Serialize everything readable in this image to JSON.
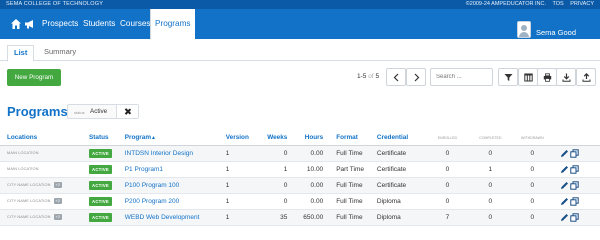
{
  "topbar": {
    "school": "SEMA COLLEGE OF TECHNOLOGY",
    "copyright": "©2009-24 AMPEDUCATOR INC.",
    "tos": "TOS",
    "privacy": "PRIVACY",
    "bg_color": "#0b5aa8"
  },
  "nav": {
    "home_icon": "home-icon",
    "announce_icon": "megaphone-icon",
    "items": [
      "Prospects",
      "Students",
      "Courses",
      "Programs"
    ],
    "active": "Programs",
    "user_name": "Sema Good",
    "bg_color": "#1272c8"
  },
  "subtabs": [
    "List",
    "Summary"
  ],
  "toolbar": {
    "new_button": "New Program",
    "pager_range": "1-5",
    "pager_of": "of",
    "pager_total": "5",
    "search_placeholder": "Search ...",
    "icons": [
      "chevron-left-icon",
      "chevron-right-icon",
      "filter-icon",
      "columns-icon",
      "print-icon",
      "download-icon",
      "upload-icon"
    ],
    "accent": "#43a83f"
  },
  "title": "Programs",
  "filter": {
    "label": "status",
    "value": "Active"
  },
  "table": {
    "headers": {
      "locations": "Locations",
      "status": "Status",
      "program": "Program",
      "version": "Version",
      "weeks": "Weeks",
      "hours": "Hours",
      "format": "Format",
      "credential": "Credential",
      "enrolled": "ENROLLED",
      "completed": "COMPLETED",
      "withdrawn": "WITHDRAWN"
    },
    "rows": [
      {
        "location": "MAIN LOCATION",
        "count": "",
        "status": "ACTIVE",
        "program": "INTDSN Interior Design",
        "version": "1",
        "weeks": "0",
        "hours": "0.00",
        "format": "Full Time",
        "credential": "Certificate",
        "enrolled": "0",
        "completed": "0",
        "withdrawn": "0"
      },
      {
        "location": "MAIN LOCATION",
        "count": "",
        "status": "ACTIVE",
        "program": "P1 Program1",
        "version": "1",
        "weeks": "1",
        "hours": "10.00",
        "format": "Part Time",
        "credential": "Certificate",
        "enrolled": "0",
        "completed": "1",
        "withdrawn": "0"
      },
      {
        "location": "CITY NAME LOCATION",
        "count": "+2",
        "status": "ACTIVE",
        "program": "P100 Program 100",
        "version": "1",
        "weeks": "0",
        "hours": "0.00",
        "format": "Full Time",
        "credential": "Certificate",
        "enrolled": "0",
        "completed": "0",
        "withdrawn": "0"
      },
      {
        "location": "CITY NAME LOCATION",
        "count": "+2",
        "status": "ACTIVE",
        "program": "P200 Program 200",
        "version": "1",
        "weeks": "0",
        "hours": "0.00",
        "format": "Full Time",
        "credential": "Diploma",
        "enrolled": "0",
        "completed": "0",
        "withdrawn": "0"
      },
      {
        "location": "CITY NAME LOCATION",
        "count": "+2",
        "status": "ACTIVE",
        "program": "WEBD Web Development",
        "version": "1",
        "weeks": "35",
        "hours": "650.00",
        "format": "Full Time",
        "credential": "Diploma",
        "enrolled": "7",
        "completed": "0",
        "withdrawn": "0"
      }
    ],
    "row_action_icons": [
      "edit-icon",
      "copy-icon"
    ]
  }
}
